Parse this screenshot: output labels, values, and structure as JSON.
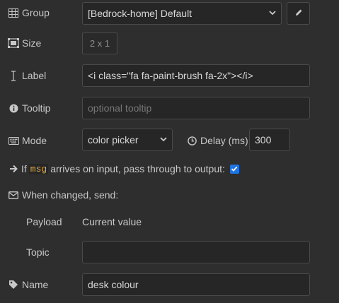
{
  "group": {
    "label": "Group",
    "icon": "table-icon",
    "value": "[Bedrock-home] Default"
  },
  "size": {
    "label": "Size",
    "icon": "object-group-icon",
    "value": "2 x 1"
  },
  "label_field": {
    "label": "Label",
    "icon": "i-cursor-icon",
    "value": "<i class=\"fa fa-paint-brush fa-2x\"></i>"
  },
  "tooltip": {
    "label": "Tooltip",
    "icon": "info-circle-icon",
    "placeholder": "optional tooltip"
  },
  "mode": {
    "label": "Mode",
    "icon": "keyboard-icon",
    "value": "color picker"
  },
  "delay": {
    "label": "Delay (ms)",
    "icon": "clock-icon",
    "value": "300"
  },
  "passthrough": {
    "prefix": "If",
    "code": "msg",
    "suffix": "arrives on input, pass through to output:",
    "checked": true
  },
  "when_changed": {
    "label": "When changed, send:",
    "icon": "envelope-icon"
  },
  "payload": {
    "label": "Payload",
    "value": "Current value"
  },
  "topic": {
    "label": "Topic",
    "value": ""
  },
  "name": {
    "label": "Name",
    "icon": "tag-icon",
    "value": "desk colour"
  }
}
